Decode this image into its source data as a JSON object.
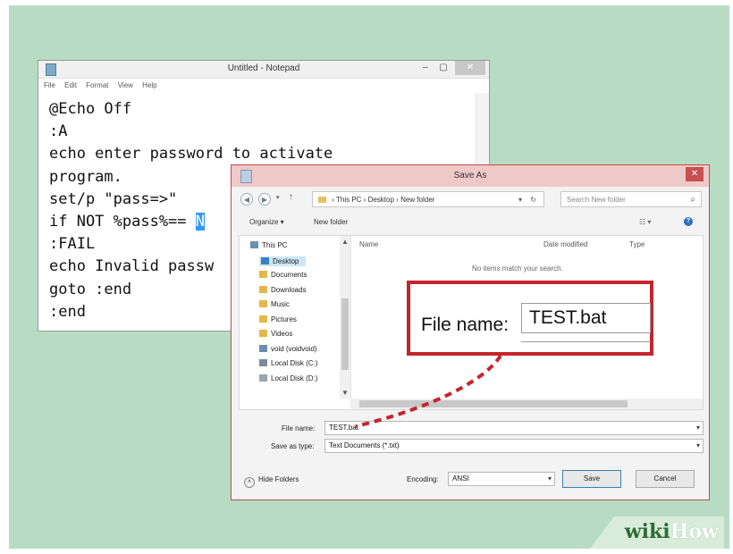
{
  "notepad": {
    "title": "Untitled - Notepad",
    "controls": {
      "minimize": "–",
      "maximize": "▢",
      "close": "✕"
    },
    "menu": [
      "File",
      "Edit",
      "Format",
      "View",
      "Help"
    ],
    "lines": [
      "@Echo Off",
      ":A",
      "echo enter password to activate",
      "program.",
      "set/p \"pass=>\"",
      "if NOT %pass%== ",
      ":FAIL",
      "echo Invalid passw",
      "goto :end",
      ":end"
    ],
    "selected_text": "N"
  },
  "dialog": {
    "title": "Save As",
    "close": "✕",
    "address": {
      "parts": [
        "This PC",
        "Desktop",
        "New folder"
      ],
      "separator": "›"
    },
    "search_placeholder": "Search New folder",
    "toolbar": {
      "organize": "Organize ▾",
      "new_folder": "New folder",
      "view": "☷ ▾",
      "help": "?"
    },
    "sidebar": [
      {
        "label": "This PC",
        "icon": "computer-icon",
        "color": "#6a8fb3",
        "top": true
      },
      {
        "label": "Desktop",
        "icon": "folder-icon",
        "color": "#3a7fc4",
        "selected": true
      },
      {
        "label": "Documents",
        "icon": "folder-icon",
        "color": "#e2b84a"
      },
      {
        "label": "Downloads",
        "icon": "folder-icon",
        "color": "#e2b84a"
      },
      {
        "label": "Music",
        "icon": "folder-icon",
        "color": "#e2b84a"
      },
      {
        "label": "Pictures",
        "icon": "folder-icon",
        "color": "#e2b84a"
      },
      {
        "label": "Videos",
        "icon": "folder-icon",
        "color": "#e2b84a"
      },
      {
        "label": "void (voidvoid)",
        "icon": "user-icon",
        "color": "#6a8fb3"
      },
      {
        "label": "Local Disk (C:)",
        "icon": "drive-icon",
        "color": "#7a8b99"
      },
      {
        "label": "Local Disk (D:)",
        "icon": "drive-icon",
        "color": "#9aa5ae"
      }
    ],
    "columns": [
      "Name",
      "Date modified",
      "Type"
    ],
    "empty_message": "No items match your search.",
    "file_name_label": "File name:",
    "file_name_value": "TEST.bat",
    "save_as_type_label": "Save as type:",
    "save_as_type_value": "Text Documents (*.txt)",
    "hide_folders": "Hide Folders",
    "encoding_label": "Encoding:",
    "encoding_value": "ANSI",
    "save_button": "Save",
    "cancel_button": "Cancel"
  },
  "callout": {
    "label": "File name:",
    "value": "TEST.bat",
    "border_color": "#c4242b"
  },
  "watermark": {
    "part1": "wiki",
    "part2": "How"
  }
}
